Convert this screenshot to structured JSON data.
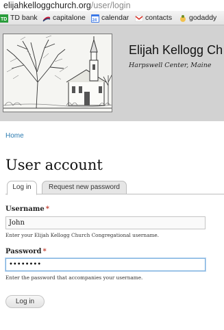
{
  "browser": {
    "url_host": "elijahkelloggchurch.org",
    "url_path": "/user/login",
    "bookmarks": [
      {
        "label": "TD bank",
        "icon": "td-bank-icon",
        "color": "#2a9d3b"
      },
      {
        "label": "capitalone",
        "icon": "capitalone-icon",
        "color": "#1d3f73"
      },
      {
        "label": "calendar",
        "icon": "calendar-icon",
        "badge": "24",
        "color": "#3b78e7"
      },
      {
        "label": "contacts",
        "icon": "gmail-icon",
        "color": "#d93025"
      },
      {
        "label": "godaddy",
        "icon": "godaddy-icon",
        "color": "#6b8e23"
      }
    ]
  },
  "site": {
    "name": "Elijah Kellogg Ch",
    "slogan": "Harpswell Center, Maine",
    "header_bg": "#d2d2d2"
  },
  "breadcrumb": {
    "home": "Home"
  },
  "page": {
    "title": "User account",
    "tabs": [
      {
        "label": "Log in",
        "active": true
      },
      {
        "label": "Request new password",
        "active": false
      }
    ]
  },
  "form": {
    "username": {
      "label": "Username",
      "required_mark": "*",
      "value": "John",
      "description": "Enter your Elijah Kellogg Church Congregational username."
    },
    "password": {
      "label": "Password",
      "required_mark": "*",
      "value": "••••••••",
      "description": "Enter the password that accompanies your username."
    },
    "submit_label": "Log in"
  },
  "colors": {
    "link": "#2a7ab0",
    "required": "#c0392b",
    "focus": "#7ab0df"
  }
}
